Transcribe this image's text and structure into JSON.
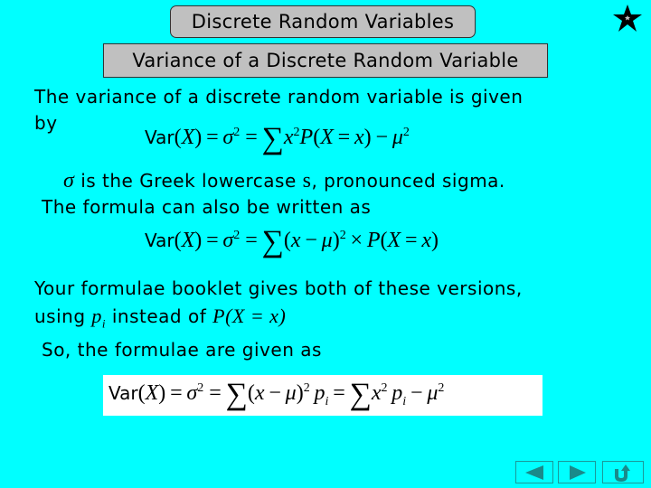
{
  "slide": {
    "title": "Discrete Random Variables",
    "subtitle": "Variance of a Discrete Random Variable",
    "background_color": "#00ffff",
    "header_box_color": "#c0c0c0"
  },
  "body": {
    "intro_line1": "The variance of a discrete random variable is given",
    "intro_line2": "by",
    "formula1": {
      "var_label": "Var",
      "parts": [
        "(",
        "X",
        ") = ",
        "σ",
        "2",
        " = ",
        "∑",
        "x",
        "2",
        "P",
        "(",
        "X",
        " = ",
        "x",
        ") − ",
        "μ",
        "2"
      ]
    },
    "sigma_note": {
      "symbol": "σ",
      "text_before": " is the Greek lowercase ",
      "letter": "s",
      "text_after": ", pronounced sigma."
    },
    "also_written": "The formula can also be written as",
    "formula2": {
      "var_label": "Var"
    },
    "booklet_line1": "Your formulae booklet gives both of these versions,",
    "booklet_line2_prefix": "using ",
    "booklet_pi": "p",
    "booklet_pi_sub": "i",
    "booklet_line2_middle": " instead of ",
    "booklet_pxx": "P(X = x)",
    "so_line": "So, the formulae are given as",
    "formula3": {
      "var_label": "Var"
    }
  },
  "nav": {
    "back_label": "previous-slide",
    "forward_label": "next-slide",
    "return_label": "return",
    "icon_color": "#1a8a8a"
  }
}
